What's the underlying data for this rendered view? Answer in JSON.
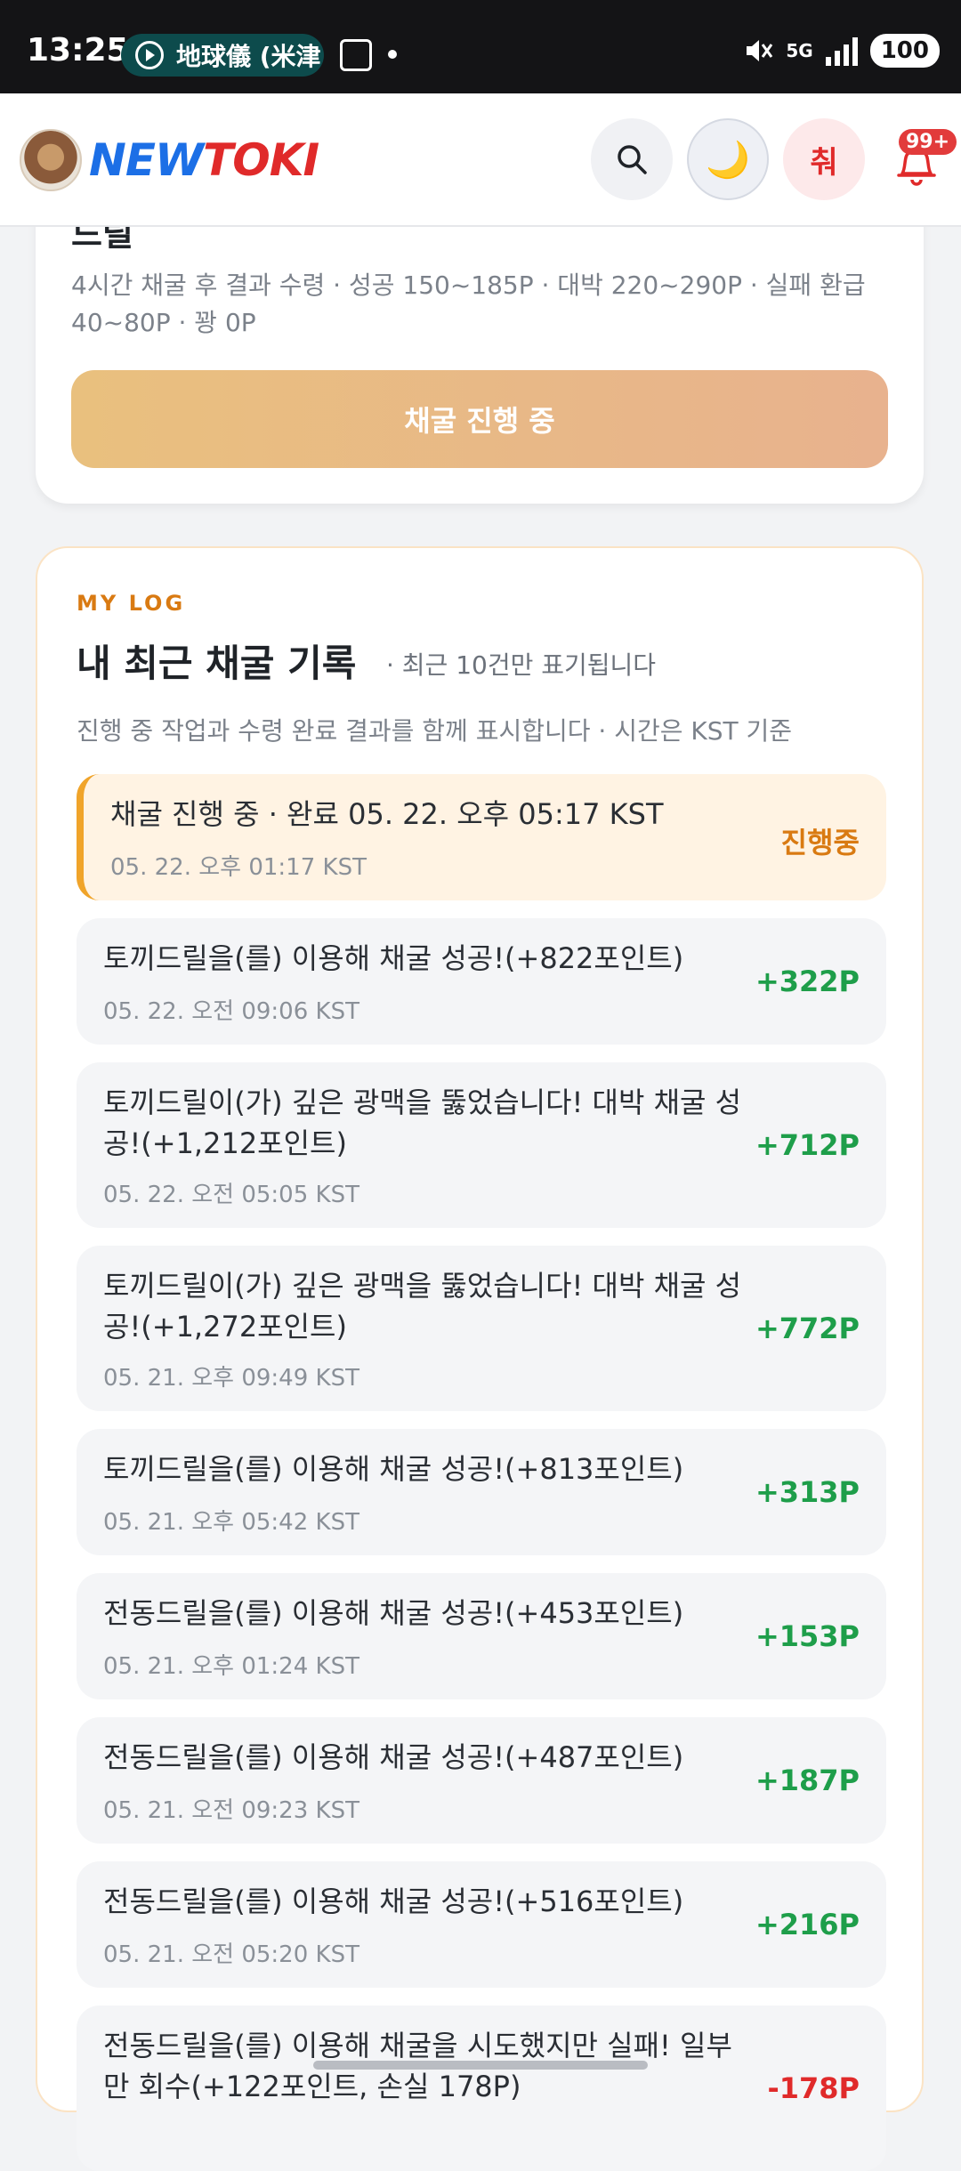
{
  "status_bar": {
    "time": "13:25",
    "media_app": "地球儀 (米津",
    "network": "5G",
    "battery": "100"
  },
  "header": {
    "logo_new": "NEW",
    "logo_toki": "TOKI",
    "cheer_label": "춰",
    "notification_badge": "99+",
    "moon_glyph": "🌙"
  },
  "top_card": {
    "title_partial": "드릴",
    "description": "4시간 채굴 후 결과 수령 · 성공 150~185P · 대박 220~290P · 실패 환급 40~80P · 꽝 0P",
    "button_label": "채굴 진행 중"
  },
  "log": {
    "eyebrow": "MY LOG",
    "title": "내 최근 채굴 기록",
    "note": "· 최근 10건만 표기됩니다",
    "subtitle": "진행 중 작업과 수령 완료 결과를 함께 표시합니다 · 시간은 KST 기준",
    "entries": [
      {
        "message": "채굴 진행 중 · 완료 05. 22. 오후 05:17 KST",
        "time": "05. 22. 오후 01:17 KST",
        "points": "진행중",
        "status": "active"
      },
      {
        "message": "토끼드릴을(를) 이용해 채굴 성공!(+822포인트)",
        "time": "05. 22. 오전 09:06 KST",
        "points": "+322P",
        "status": "success"
      },
      {
        "message": "토끼드릴이(가) 깊은 광맥을 뚫었습니다! 대박 채굴 성공!(+1,212포인트)",
        "time": "05. 22. 오전 05:05 KST",
        "points": "+712P",
        "status": "success"
      },
      {
        "message": "토끼드릴이(가) 깊은 광맥을 뚫었습니다! 대박 채굴 성공!(+1,272포인트)",
        "time": "05. 21. 오후 09:49 KST",
        "points": "+772P",
        "status": "success"
      },
      {
        "message": "토끼드릴을(를) 이용해 채굴 성공!(+813포인트)",
        "time": "05. 21. 오후 05:42 KST",
        "points": "+313P",
        "status": "success"
      },
      {
        "message": "전동드릴을(를) 이용해 채굴 성공!(+453포인트)",
        "time": "05. 21. 오후 01:24 KST",
        "points": "+153P",
        "status": "success"
      },
      {
        "message": "전동드릴을(를) 이용해 채굴 성공!(+487포인트)",
        "time": "05. 21. 오전 09:23 KST",
        "points": "+187P",
        "status": "success"
      },
      {
        "message": "전동드릴을(를) 이용해 채굴 성공!(+516포인트)",
        "time": "05. 21. 오전 05:20 KST",
        "points": "+216P",
        "status": "success"
      },
      {
        "message": "전동드릴을(를) 이용해 채굴을 시도했지만 실패! 일부만 회수(+122포인트, 손실 178P)",
        "time": "",
        "points": "-178P",
        "status": "fail"
      }
    ]
  }
}
